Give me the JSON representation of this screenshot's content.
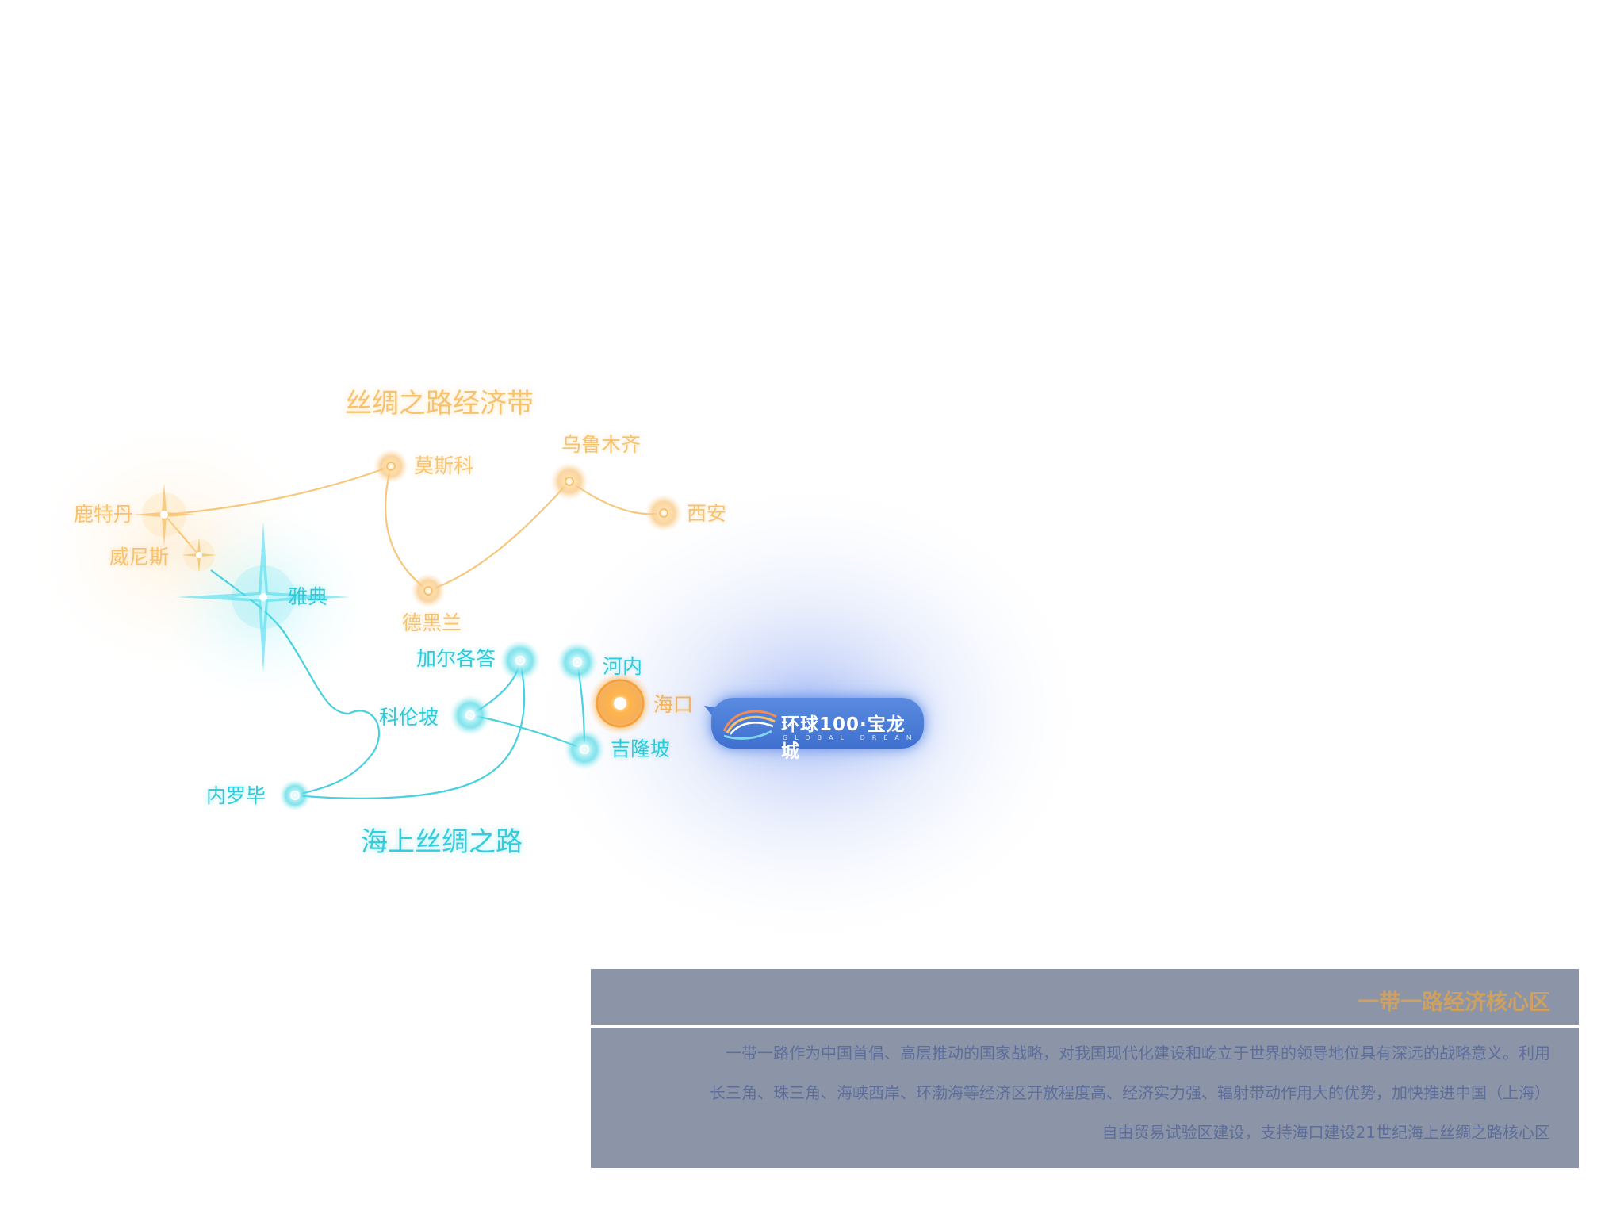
{
  "map": {
    "silk_road_title": "丝绸之路经济带",
    "maritime_title": "海上丝绸之路",
    "silk_road_cities": {
      "rotterdam": "鹿特丹",
      "venice": "威尼斯",
      "moscow": "莫斯科",
      "tehran": "德黑兰",
      "urumqi": "乌鲁木齐",
      "xian": "西安"
    },
    "maritime_cities": {
      "athens": "雅典",
      "kolkata": "加尔各答",
      "colombo": "科伦坡",
      "nairobi": "内罗毕",
      "hanoi": "河内",
      "kuala_lumpur": "吉隆坡"
    },
    "hub_city": "海口",
    "colors": {
      "silk_route": "#f6c26e",
      "maritime_route": "#35cddb",
      "hub": "#f39c2e",
      "brand_badge": "#4a7ad6"
    }
  },
  "brand": {
    "name": "环球100·宝龙城",
    "subtitle": "GLOBAL DREAM"
  },
  "panel": {
    "title": "一带一路经济核心区",
    "line1": "一带一路作为中国首倡、高层推动的国家战略，对我国现代化建设和屹立于世界的领导地位具有深远的战略意义。利用",
    "line2": "长三角、珠三角、海峡西岸、环渤海等经济区开放程度高、经济实力强、辐射带动作用大的优势，加快推进中国（上海）",
    "line3": "自由贸易试验区建设，支持海口建设21世纪海上丝绸之路核心区"
  }
}
